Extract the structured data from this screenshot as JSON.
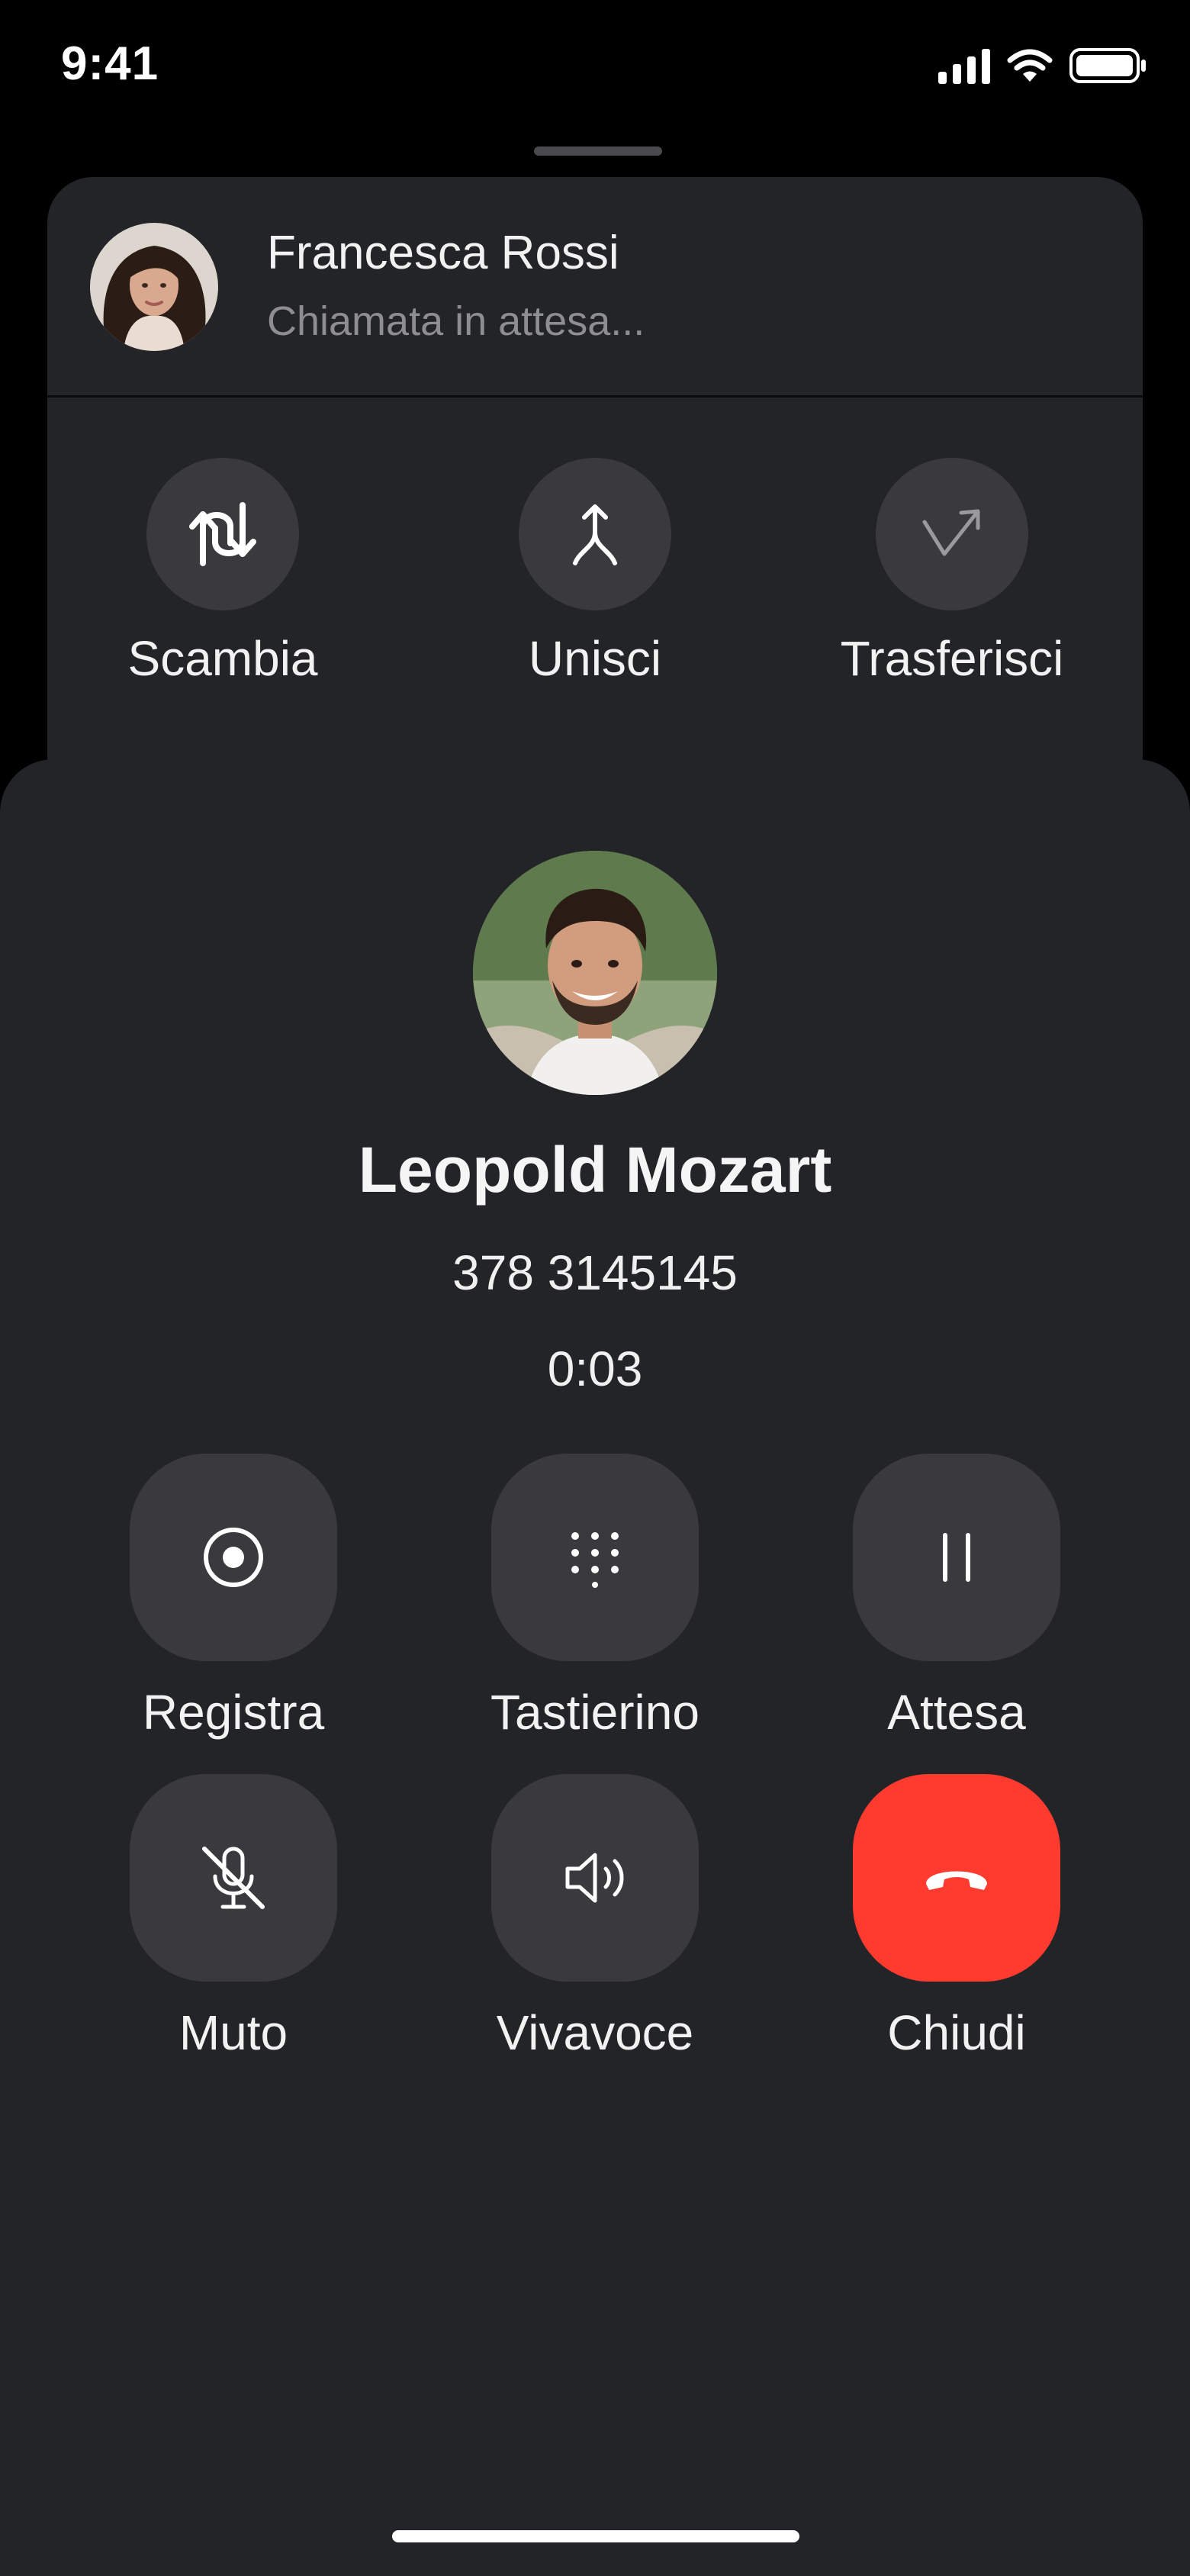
{
  "status_bar": {
    "time": "9:41"
  },
  "held_call": {
    "name": "Francesca Rossi",
    "status": "Chiamata in attesa...",
    "actions": [
      {
        "label": "Scambia",
        "icon": "swap-icon"
      },
      {
        "label": "Unisci",
        "icon": "merge-icon"
      },
      {
        "label": "Trasferisci",
        "icon": "transfer-icon"
      }
    ]
  },
  "active_call": {
    "name": "Leopold Mozart",
    "number": "378 3145145",
    "duration": "0:03",
    "controls": [
      {
        "label": "Registra",
        "icon": "record-icon"
      },
      {
        "label": "Tastierino",
        "icon": "keypad-icon"
      },
      {
        "label": "Attesa",
        "icon": "pause-icon"
      },
      {
        "label": "Muto",
        "icon": "mic-off-icon"
      },
      {
        "label": "Vivavoce",
        "icon": "speaker-icon"
      },
      {
        "label": "Chiudi",
        "icon": "end-call-icon"
      }
    ]
  },
  "colors": {
    "background": "#000000",
    "sheet": "#232427",
    "button": "#3a3a3e",
    "end_call": "#ff3b30",
    "secondary_text": "#8d8d92"
  }
}
